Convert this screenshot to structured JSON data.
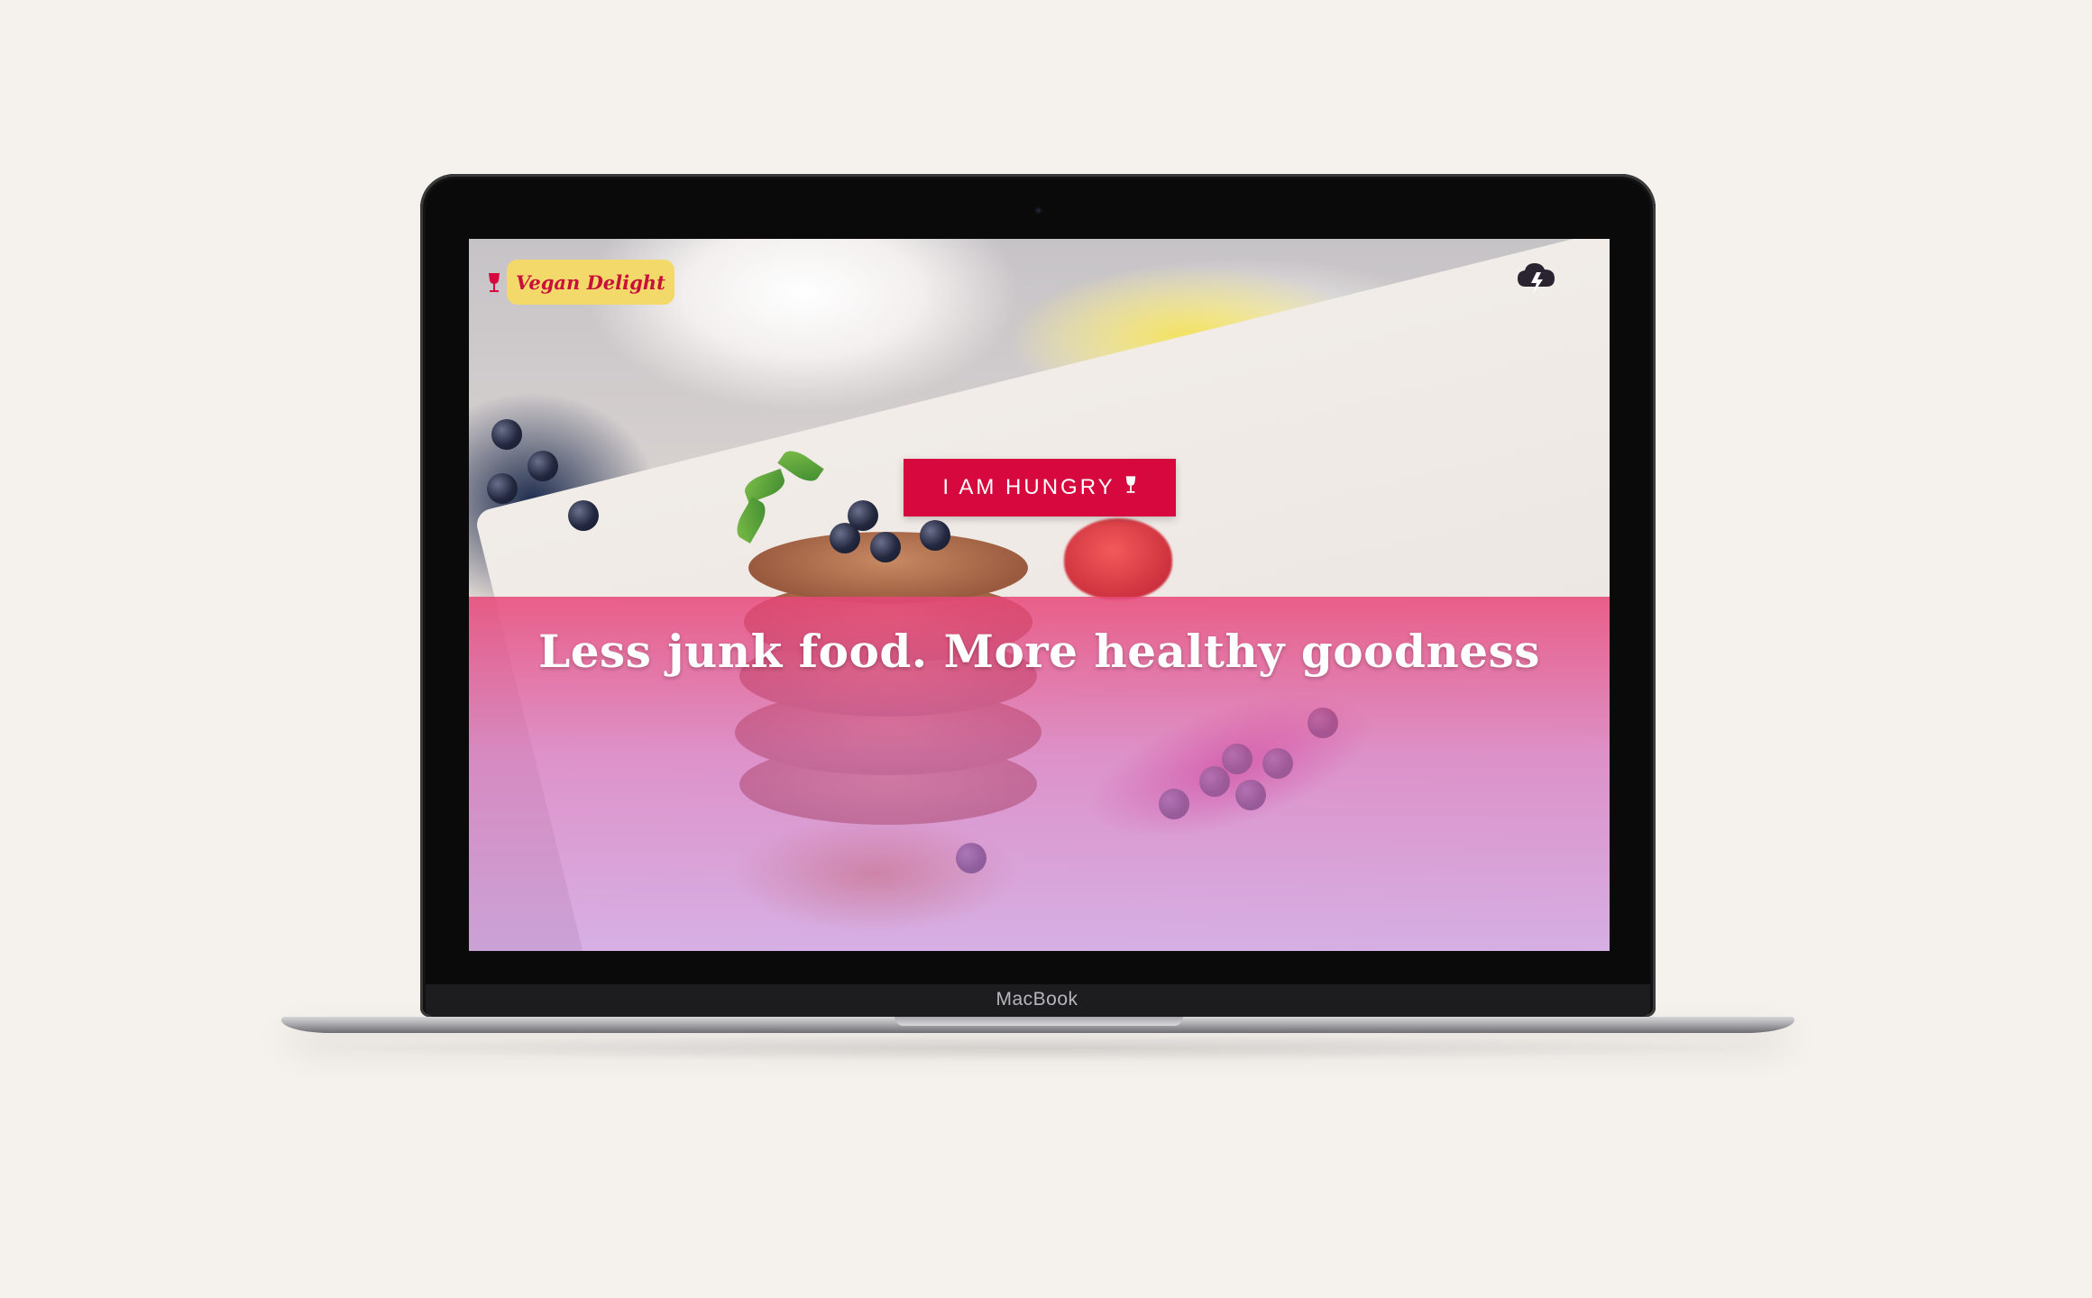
{
  "device": {
    "brand_label": "MacBook"
  },
  "site": {
    "logo_text": "Vegan Delight",
    "logo_icon": "wine-glass-icon",
    "menu_icon": "cloud-lightning-icon",
    "cta_label": "I AM HUNGRY",
    "cta_icon": "wine-glass-icon",
    "headline": "Less junk food. More healthy goodness"
  },
  "colors": {
    "accent": "#d6083d",
    "logo_badge": "#f3d96a",
    "logo_text": "#c8103a",
    "overlay": "#e84678",
    "page_background": "#f5f1ed"
  }
}
